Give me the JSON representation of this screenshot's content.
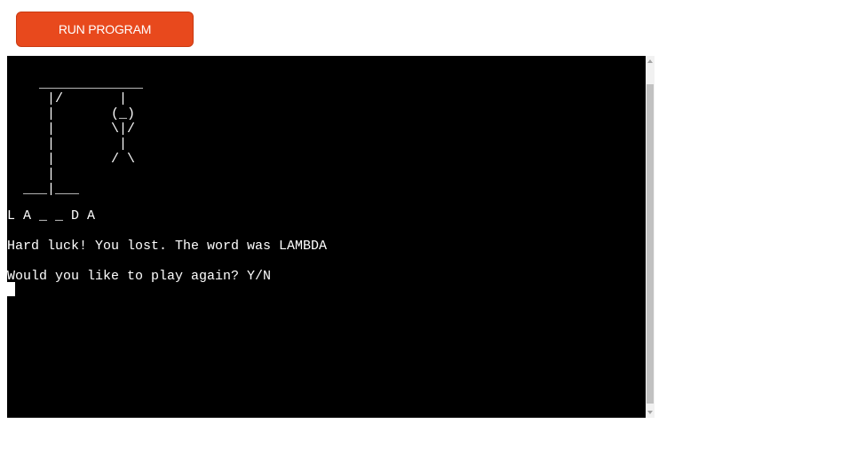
{
  "run_button": {
    "label": "RUN PROGRAM"
  },
  "terminal": {
    "gallows_art": "    _____________\n     |/       |\n     |       (_)\n     |       \\|/\n     |        |\n     |       / \\\n     |\n  ___|___",
    "word_progress": "L A _ _ D A",
    "result_message": "Hard luck! You lost. The word was LAMBDA",
    "play_again_prompt": "Would you like to play again? Y/N"
  },
  "colors": {
    "button_bg": "#e8491d",
    "terminal_bg": "#000000",
    "terminal_text": "#ffffff",
    "scrollbar_track": "#f1f1f1",
    "scrollbar_thumb": "#c1c1c1"
  },
  "icons": {
    "scroll_up": "triangle-up-icon",
    "scroll_down": "triangle-down-icon"
  }
}
